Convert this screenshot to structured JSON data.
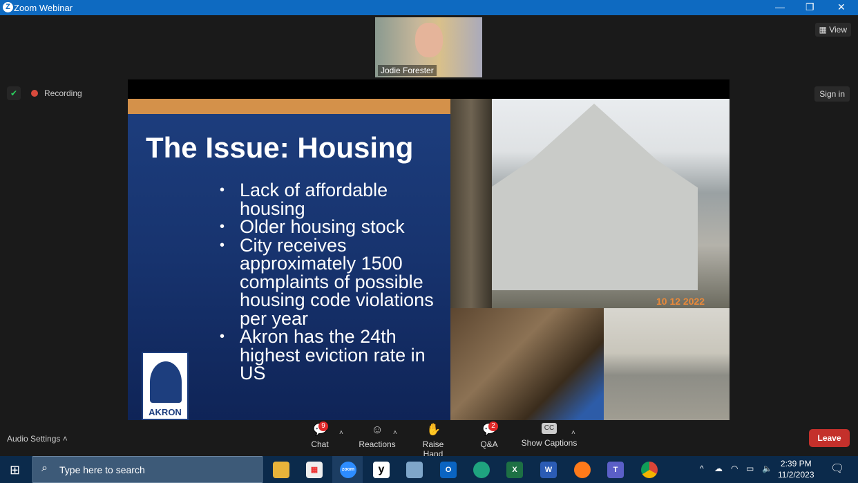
{
  "window": {
    "title": "Zoom Webinar"
  },
  "speaker": {
    "name": "Jodie Forester"
  },
  "header": {
    "view_label": "View",
    "sign_in_label": "Sign in",
    "recording_label": "Recording"
  },
  "slide": {
    "title": "The Issue: Housing",
    "bullets": [
      "Lack of affordable housing",
      "Older housing stock",
      "City receives approximately 1500 complaints of possible housing code violations per year",
      "Akron has the 24th highest eviction rate in US"
    ],
    "logo_text": "AKRON",
    "photo_date": "10 12 2022"
  },
  "toolbar": {
    "audio_settings": "Audio Settings",
    "chat": "Chat",
    "chat_badge": "9",
    "reactions": "Reactions",
    "raise_hand": "Raise Hand",
    "qa": "Q&A",
    "qa_badge": "2",
    "captions": "Show Captions",
    "captions_icon": "CC",
    "leave": "Leave"
  },
  "taskbar": {
    "search_placeholder": "Type here to search",
    "time": "2:39 PM",
    "date": "11/2/2023",
    "apps": [
      "file-explorer",
      "store",
      "zoom",
      "yahoo",
      "app",
      "outlook",
      "edge",
      "excel",
      "word",
      "firefox",
      "teams",
      "chrome"
    ],
    "zoom_label": "zoom"
  },
  "colors": {
    "leave": "#c4302b",
    "titlebar": "#0e6ac1",
    "slide_bg": "#1d3e7e",
    "accent_bar": "#d4914a"
  }
}
